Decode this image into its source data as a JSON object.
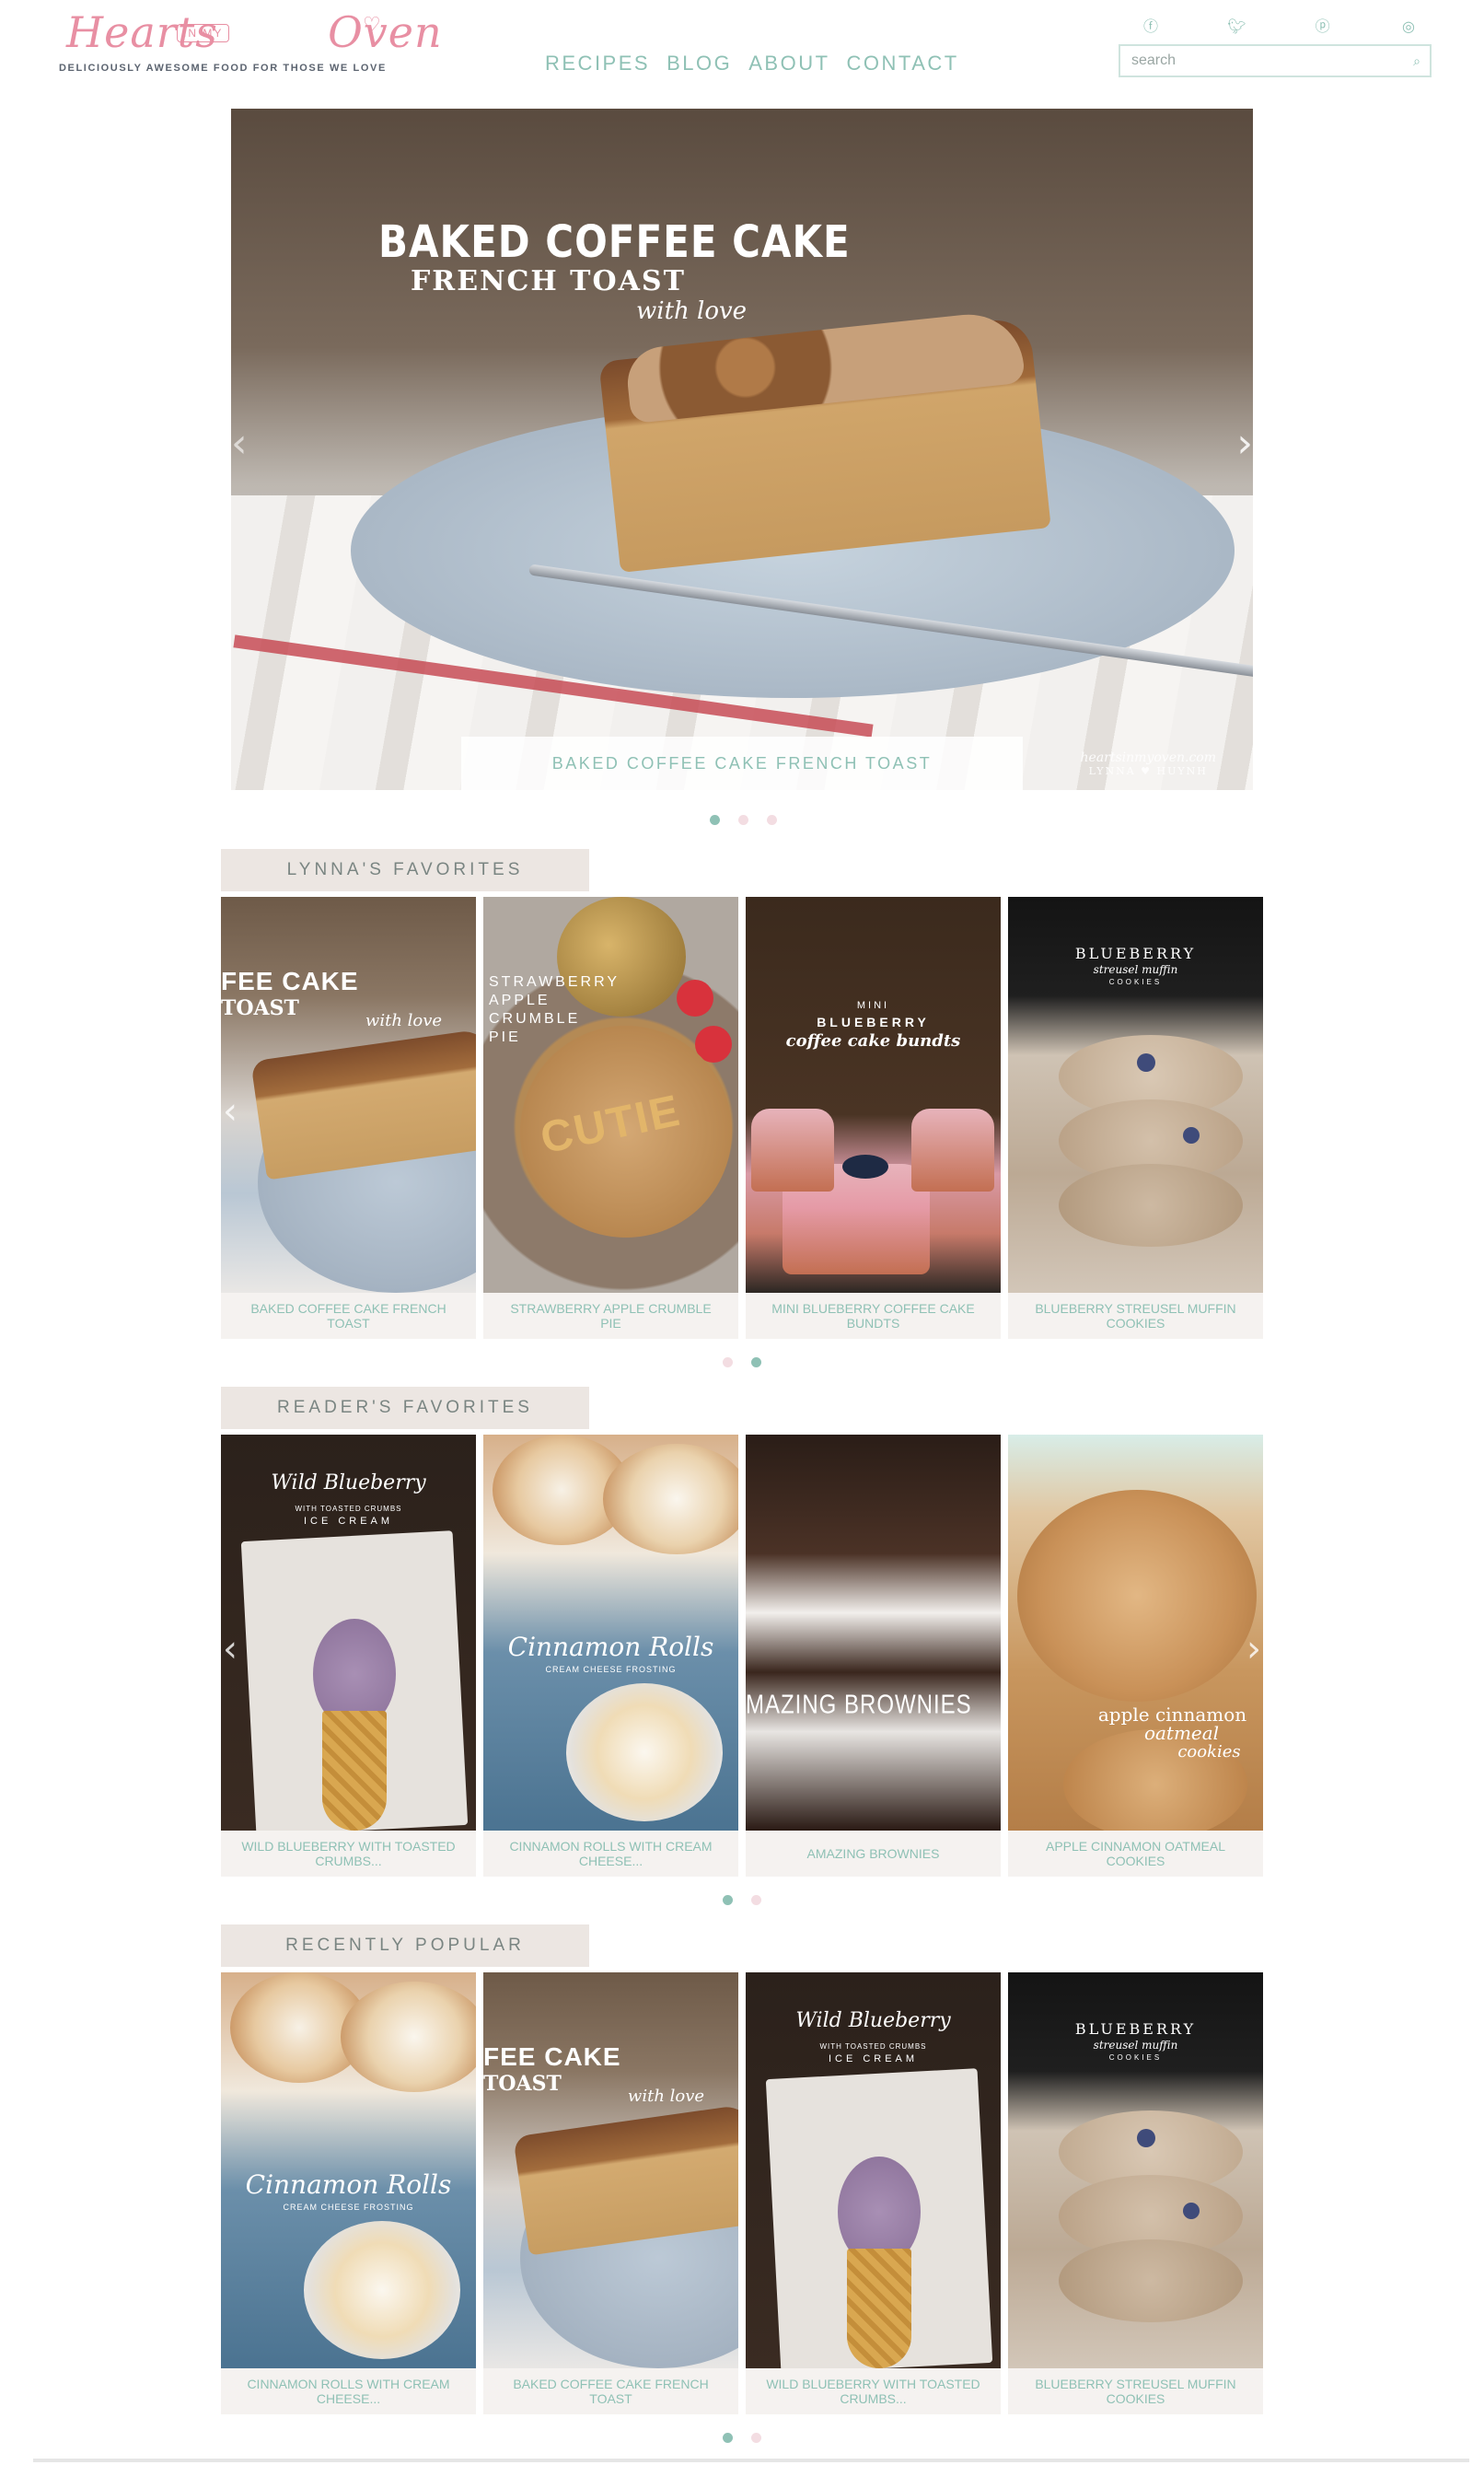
{
  "logo": {
    "script_left": "Hearts",
    "in_my": "IN MY",
    "script_right": "Oven",
    "heart": "♡",
    "tagline": "DELICIOUSLY AWESOME FOOD FOR THOSE WE LOVE"
  },
  "nav": {
    "items": [
      "RECIPES",
      "BLOG",
      "ABOUT",
      "CONTACT"
    ]
  },
  "social": {
    "icons": [
      {
        "name": "facebook-icon",
        "glyph": "ⓕ"
      },
      {
        "name": "twitter-icon",
        "glyph": "🐦︎"
      },
      {
        "name": "pinterest-icon",
        "glyph": "ⓟ"
      },
      {
        "name": "instagram-icon",
        "glyph": "◎"
      }
    ]
  },
  "search": {
    "placeholder": "search",
    "value": "",
    "icon": "⌕"
  },
  "hero": {
    "title_line1": "BAKED COFFEE CAKE",
    "title_line2": "FRENCH TOAST",
    "signature": "with love",
    "watermark_line1": "heartsinmyoven.com",
    "watermark_line2": "LYNNA ♥ HUYNH",
    "caption": "BAKED COFFEE CAKE FRENCH TOAST",
    "arrow_left": "‹",
    "arrow_right": "›",
    "dots": 3,
    "active_dot": 0
  },
  "sections": [
    {
      "title": "LYNNA'S FAVORITES",
      "dots": 2,
      "active_dot": 1,
      "show_left_arrow": true,
      "show_right_arrow": false,
      "cards": [
        {
          "label": "BAKED COFFEE CAKE FRENCH TOAST",
          "style": "coffee",
          "overlay1": "FEE CAKE",
          "overlay2": "TOAST",
          "overlay3": "with love"
        },
        {
          "label": "STRAWBERRY APPLE CRUMBLE PIE",
          "style": "strawberry",
          "overlay1": "STRAWBERRY",
          "overlay2": "APPLE",
          "overlay3": "CRUMBLE",
          "overlay4": "PIE",
          "overlay5": "CUTIE"
        },
        {
          "label": "MINI BLUEBERRY COFFEE CAKE BUNDTS",
          "style": "bundt",
          "overlay1": "MINI",
          "overlay2": "BLUEBERRY",
          "overlay3": "coffee cake bundts"
        },
        {
          "label": "BLUEBERRY STREUSEL MUFFIN COOKIES",
          "style": "blueberry",
          "overlay1": "BLUEBERRY",
          "overlay2": "streusel muffin",
          "overlay3": "COOKIES"
        }
      ]
    },
    {
      "title": "READER'S FAVORITES",
      "dots": 2,
      "active_dot": 0,
      "show_left_arrow": true,
      "show_right_arrow": true,
      "cards": [
        {
          "label": "WILD BLUEBERRY WITH TOASTED CRUMBS...",
          "style": "icecream",
          "overlay1": "Wild Blueberry",
          "overlay2": "WITH TOASTED CRUMBS",
          "overlay3": "ICE CREAM"
        },
        {
          "label": "CINNAMON ROLLS WITH CREAM CHEESE...",
          "style": "cinnamon",
          "overlay1": "Cinnamon Rolls",
          "overlay2": "CREAM CHEESE FROSTING"
        },
        {
          "label": "AMAZING BROWNIES",
          "style": "brownie",
          "overlay1": "MAZING BROWNIES"
        },
        {
          "label": "APPLE CINNAMON OATMEAL COOKIES",
          "style": "apple",
          "overlay1": "apple cinnamon",
          "overlay2": "oatmeal",
          "overlay3": "cookies"
        }
      ]
    },
    {
      "title": "RECENTLY POPULAR",
      "dots": 2,
      "active_dot": 0,
      "show_left_arrow": false,
      "show_right_arrow": false,
      "cards": [
        {
          "label": "CINNAMON ROLLS WITH CREAM CHEESE...",
          "style": "cinnamon",
          "overlay1": "Cinnamon Rolls",
          "overlay2": "CREAM CHEESE FROSTING"
        },
        {
          "label": "BAKED COFFEE CAKE FRENCH TOAST",
          "style": "coffee",
          "overlay1": "FEE CAKE",
          "overlay2": "TOAST",
          "overlay3": "with love"
        },
        {
          "label": "WILD BLUEBERRY WITH TOASTED CRUMBS...",
          "style": "icecream",
          "overlay1": "Wild Blueberry",
          "overlay2": "WITH TOASTED CRUMBS",
          "overlay3": "ICE CREAM"
        },
        {
          "label": "BLUEBERRY STREUSEL MUFFIN COOKIES",
          "style": "blueberry",
          "overlay1": "BLUEBERRY",
          "overlay2": "streusel muffin",
          "overlay3": "COOKIES"
        }
      ]
    }
  ],
  "colors": {
    "accent": "#8fc1b5",
    "logo_pink": "#e88fa3",
    "tab_bg": "#ece6e2",
    "dot_inactive": "#f3dde2"
  }
}
